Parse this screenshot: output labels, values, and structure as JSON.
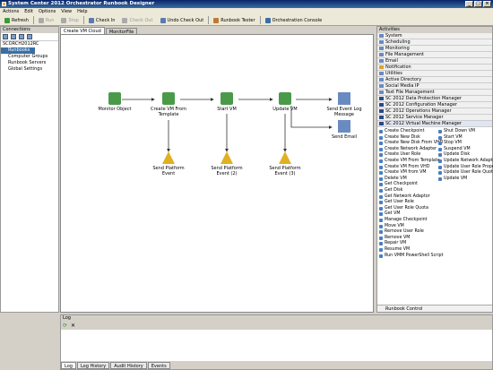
{
  "window": {
    "title": "System Center 2012 Orchestrator Runbook Designer",
    "buttons": [
      "_",
      "□",
      "×"
    ]
  },
  "menu": [
    "Actions",
    "Edit",
    "Options",
    "View",
    "Help"
  ],
  "toolbar": {
    "refresh": "Refresh",
    "run": "Run",
    "stop": "Stop",
    "check_in": "Check In",
    "check_out": "Check Out",
    "undo_check_out": "Undo Check Out",
    "runbook_tester": "Runbook Tester",
    "orch_console": "Orchestration Console"
  },
  "connections": {
    "title": "Connections",
    "tree": [
      "SCORCH2012RC",
      "Runbooks",
      "Computer Groups",
      "Runbook Servers",
      "Global Settings"
    ]
  },
  "tabs": [
    "Create VM Cloud",
    "MonitorFile"
  ],
  "workflow": {
    "monitor": "Monitor Object",
    "create_vm": "Create VM From Template",
    "start_vm": "Start VM",
    "update_vm": "Update VM",
    "send_event_log": "Send Event Log Message",
    "send_email": "Send Email",
    "spe1": "Send Platform Event",
    "spe2": "Send Platform Event (2)",
    "spe3": "Send Platform Event (3)"
  },
  "activities": {
    "title": "Activities",
    "categories": [
      "System",
      "Scheduling",
      "Monitoring",
      "File Management",
      "Email",
      "Notification",
      "Utilities",
      "Active Directory",
      "Social Media IP",
      "Text File Management",
      "SC 2012 Data Protection Manager",
      "SC 2012 Configuration Manager",
      "SC 2012 Operations Manager",
      "SC 2012 Service Manager",
      "SC 2012 Virtual Machine Manager"
    ],
    "vmm_col1": [
      "Create Checkpoint",
      "Create New Disk",
      "Create New Disk From VHD",
      "Create Network Adapter",
      "Create User Role",
      "Create VM From Template",
      "Create VM From VHD",
      "Create VM from VM",
      "Delete VM",
      "Get Checkpoint",
      "Get Disk",
      "Get Network Adaptor",
      "Get User Role",
      "Get User Role Quota",
      "Get VM",
      "Manage Checkpoint",
      "Move VM",
      "Remove User Role",
      "Remove VM",
      "Repair VM",
      "Resume VM",
      "Run VMM PowerShell Script"
    ],
    "vmm_col2": [
      "Shut Down VM",
      "Start VM",
      "Stop VM",
      "Suspend VM",
      "Update Disk",
      "Update Network Adapter",
      "Update User Role Property",
      "Update User Role Quota",
      "Update VM"
    ],
    "runbook_control": "Runbook Control"
  },
  "log": {
    "title": "Log",
    "tabs": [
      "Log",
      "Log History",
      "Audit History",
      "Events"
    ]
  },
  "colors": {
    "accent": "#0a246a",
    "title_grad_end": "#3a6ea5"
  }
}
